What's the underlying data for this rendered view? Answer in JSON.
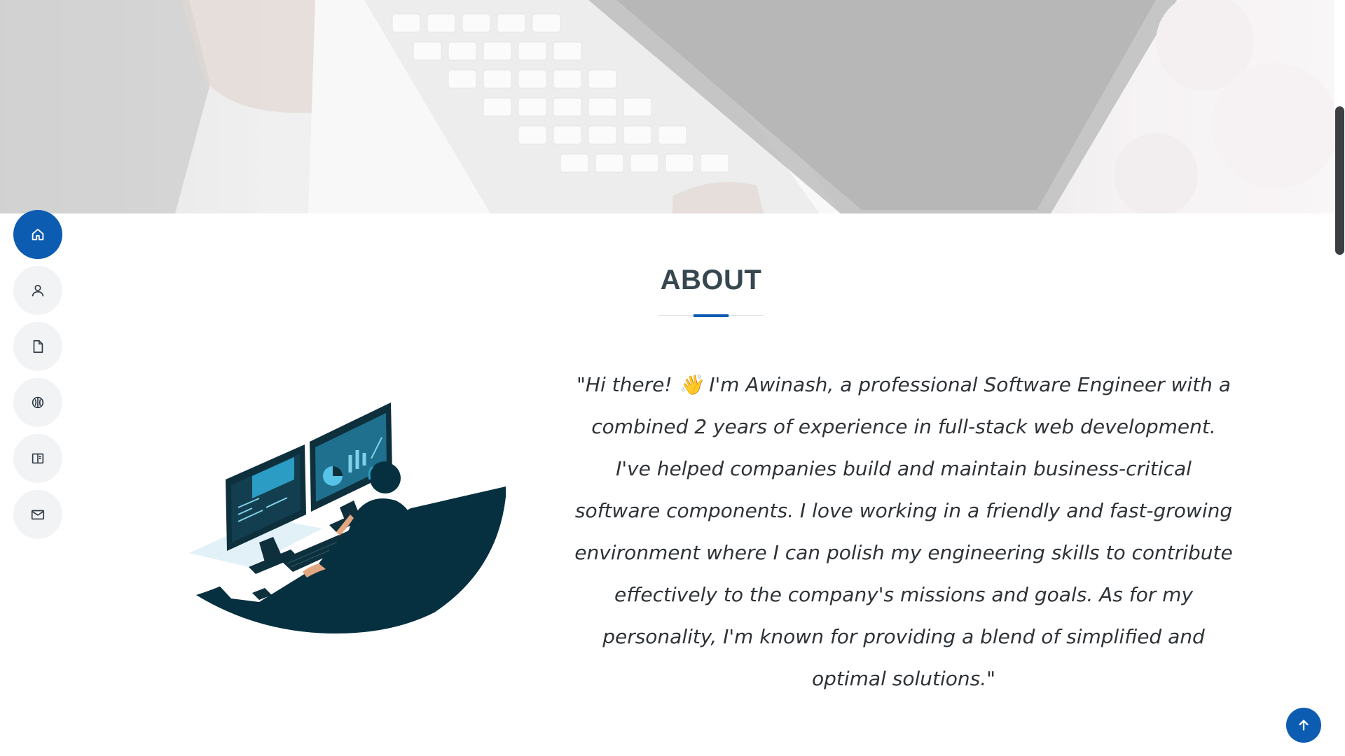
{
  "about": {
    "title": "ABOUT",
    "text": "\"Hi there! 👋 I'm Awinash, a professional Software Engineer with a combined 2 years of experience in full-stack web development. I've helped companies build and maintain business-critical software components. I love working in a friendly and fast-growing environment where I can polish my engineering skills to contribute effectively to the company's missions and goals. As for my personality, I'm known for providing a blend of simplified and optimal solutions.\""
  },
  "nav": {
    "items": [
      {
        "icon": "home-icon",
        "active": true
      },
      {
        "icon": "person-icon",
        "active": false
      },
      {
        "icon": "file-icon",
        "active": false
      },
      {
        "icon": "skills-icon",
        "active": false
      },
      {
        "icon": "book-icon",
        "active": false
      },
      {
        "icon": "mail-icon",
        "active": false
      }
    ]
  },
  "colors": {
    "accent": "#0c5cb2",
    "title": "#37474f",
    "text": "#2e3338",
    "nav_bg": "#f2f3f5",
    "illustration_dark": "#06303f"
  }
}
